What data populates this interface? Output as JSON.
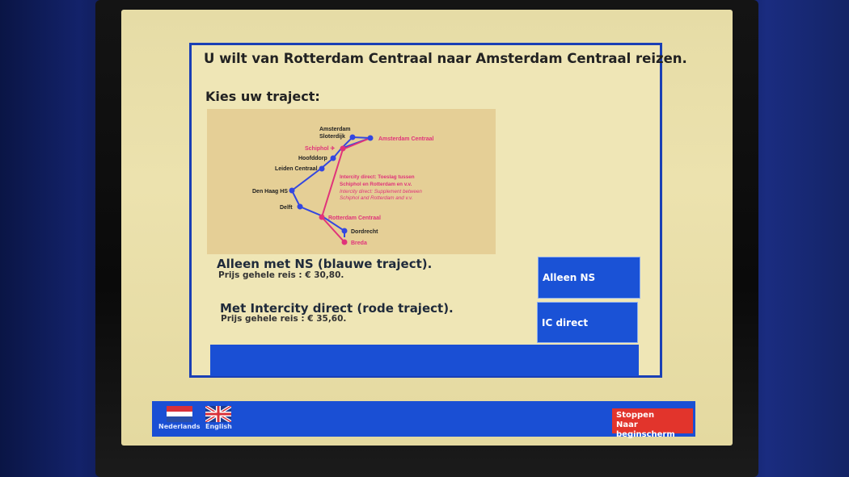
{
  "header": {
    "question": "U wilt van Rotterdam Centraal naar Amsterdam Centraal reizen.",
    "choose_route": "Kies uw traject:"
  },
  "map": {
    "stations": {
      "sloterdijk_1": "Amsterdam",
      "sloterdijk_2": "Sloterdijk",
      "amsterdam_centraal": "Amsterdam Centraal",
      "schiphol": "Schiphol ✈",
      "hoofddorp": "Hoofddorp",
      "leiden": "Leiden Centraal",
      "den_haag": "Den Haag HS",
      "delft": "Delft",
      "rotterdam": "Rotterdam Centraal",
      "dordrecht": "Dordrecht",
      "breda": "Breda"
    },
    "note_nl_1": "Intercity direct: Toeslag tussen",
    "note_nl_2": "Schiphol en Rotterdam en v.v.",
    "note_en_1": "Intercity direct: Supplement between",
    "note_en_2": "Schiphol and Rotterdam and v.v.",
    "colors": {
      "blue_route": "#3347e0",
      "red_route": "#e0337a"
    }
  },
  "options": [
    {
      "title": "Alleen met NS (blauwe traject).",
      "price": "Prijs gehele reis  : € 30,80.",
      "button": "Alleen NS"
    },
    {
      "title": "Met Intercity direct (rode traject).",
      "price": "Prijs gehele reis  : € 35,60.",
      "button": "IC direct"
    }
  ],
  "footer": {
    "lang_nl": "Nederlands",
    "lang_en": "English",
    "stop_line1": "Stoppen",
    "stop_line2": "Naar beginscherm"
  }
}
